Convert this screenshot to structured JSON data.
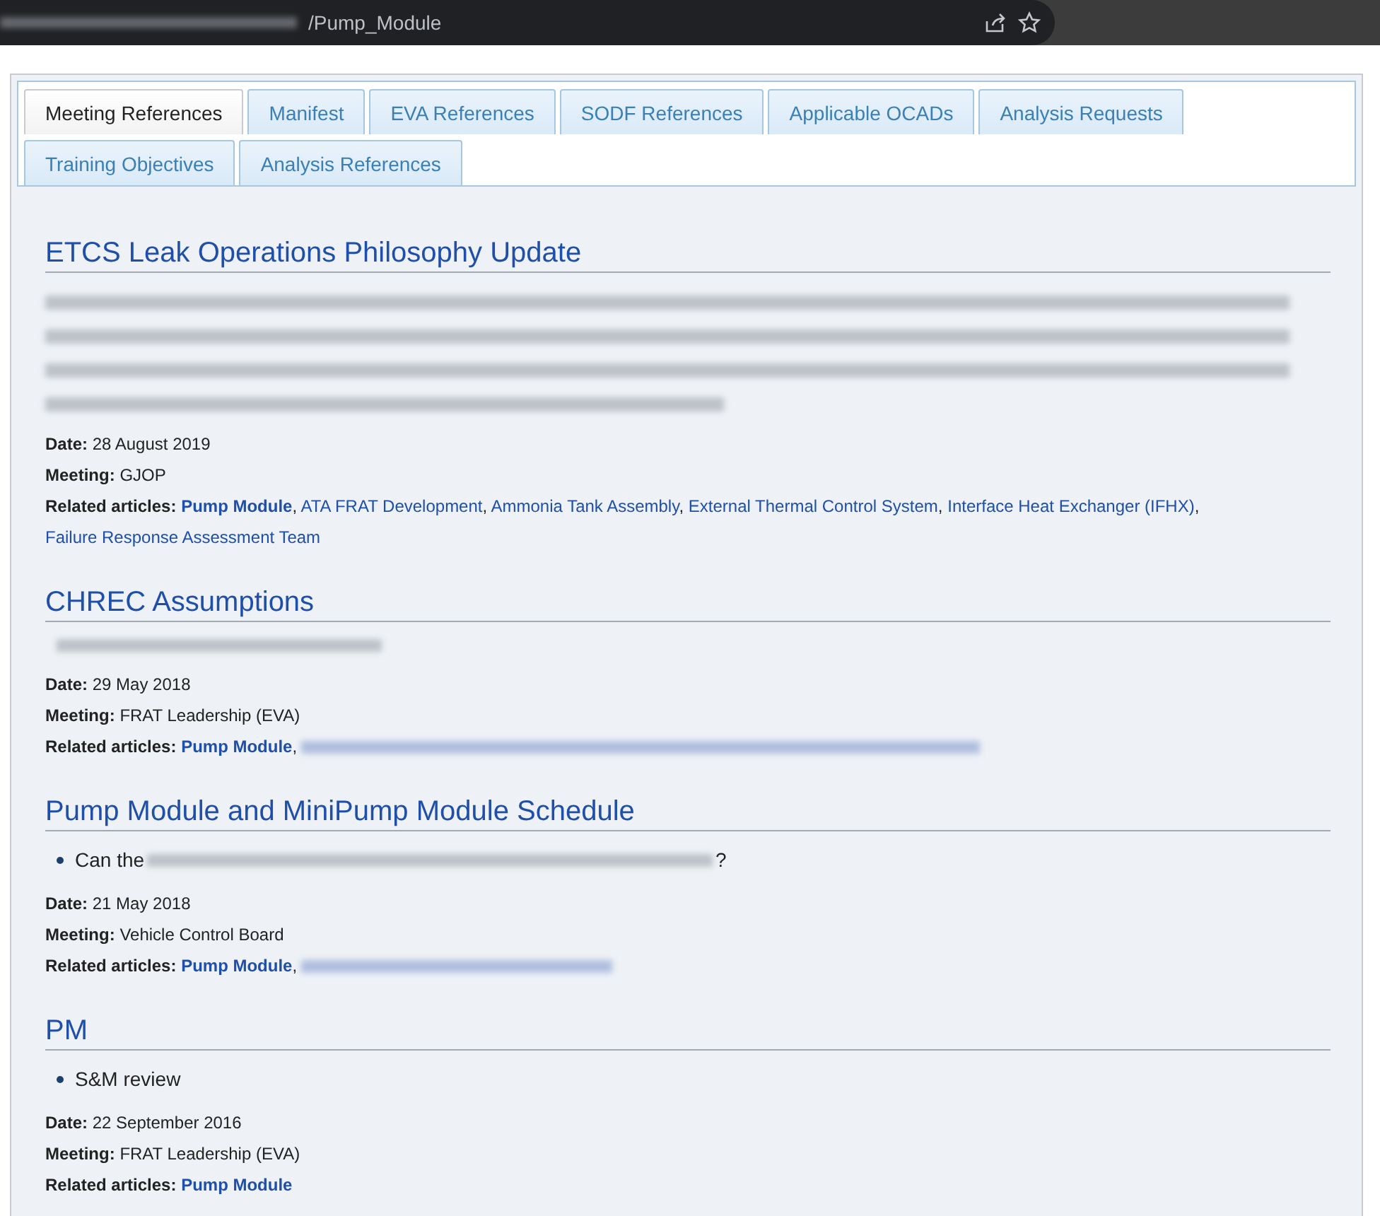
{
  "address_bar": {
    "url": "/Pump_Module"
  },
  "tabs": [
    {
      "label": "Meeting References",
      "selected": true
    },
    {
      "label": "Manifest",
      "selected": false
    },
    {
      "label": "EVA References",
      "selected": false
    },
    {
      "label": "SODF References",
      "selected": false
    },
    {
      "label": "Applicable OCADs",
      "selected": false
    },
    {
      "label": "Analysis Requests",
      "selected": false
    },
    {
      "label": "Training Objectives",
      "selected": false
    },
    {
      "label": "Analysis References",
      "selected": false
    }
  ],
  "sections": [
    {
      "title": "ETCS Leak Operations Philosophy Update",
      "body": {
        "kind": "redacted_paragraph"
      },
      "date_label": "Date:",
      "date": "28 August 2019",
      "meeting_label": "Meeting:",
      "meeting": "GJOP",
      "related_label": "Related articles:",
      "separator": ",",
      "links": [
        {
          "text": "Pump Module",
          "current": true
        },
        {
          "text": "ATA FRAT Development",
          "current": false
        },
        {
          "text": "Ammonia Tank Assembly",
          "current": false
        },
        {
          "text": "External Thermal Control System",
          "current": false
        },
        {
          "text": "Interface Heat Exchanger (IFHX)",
          "current": false
        },
        {
          "text": "Failure Response Assessment Team",
          "current": false
        }
      ],
      "more_redacted": false
    },
    {
      "title": "CHREC Assumptions",
      "body": {
        "kind": "redacted_bullet"
      },
      "date_label": "Date:",
      "date": "29 May 2018",
      "meeting_label": "Meeting:",
      "meeting": "FRAT Leadership (EVA)",
      "related_label": "Related articles:",
      "separator": ",",
      "links": [
        {
          "text": "Pump Module",
          "current": true
        }
      ],
      "more_redacted": true
    },
    {
      "title": "Pump Module and MiniPump Module Schedule",
      "body": {
        "kind": "bullet",
        "text": "Can the",
        "redacted": true,
        "tail": "?"
      },
      "date_label": "Date:",
      "date": "21 May 2018",
      "meeting_label": "Meeting:",
      "meeting": "Vehicle Control Board",
      "related_label": "Related articles:",
      "separator": ",",
      "links": [
        {
          "text": "Pump Module",
          "current": true
        }
      ],
      "more_redacted": true
    },
    {
      "title": "PM",
      "body": {
        "kind": "bullet",
        "text": "S&M review",
        "redacted": false
      },
      "date_label": "Date:",
      "date": "22 September 2016",
      "meeting_label": "Meeting:",
      "meeting": "FRAT Leadership (EVA)",
      "related_label": "Related articles:",
      "links": [
        {
          "text": "Pump Module",
          "current": true
        }
      ],
      "more_redacted": false
    }
  ]
}
